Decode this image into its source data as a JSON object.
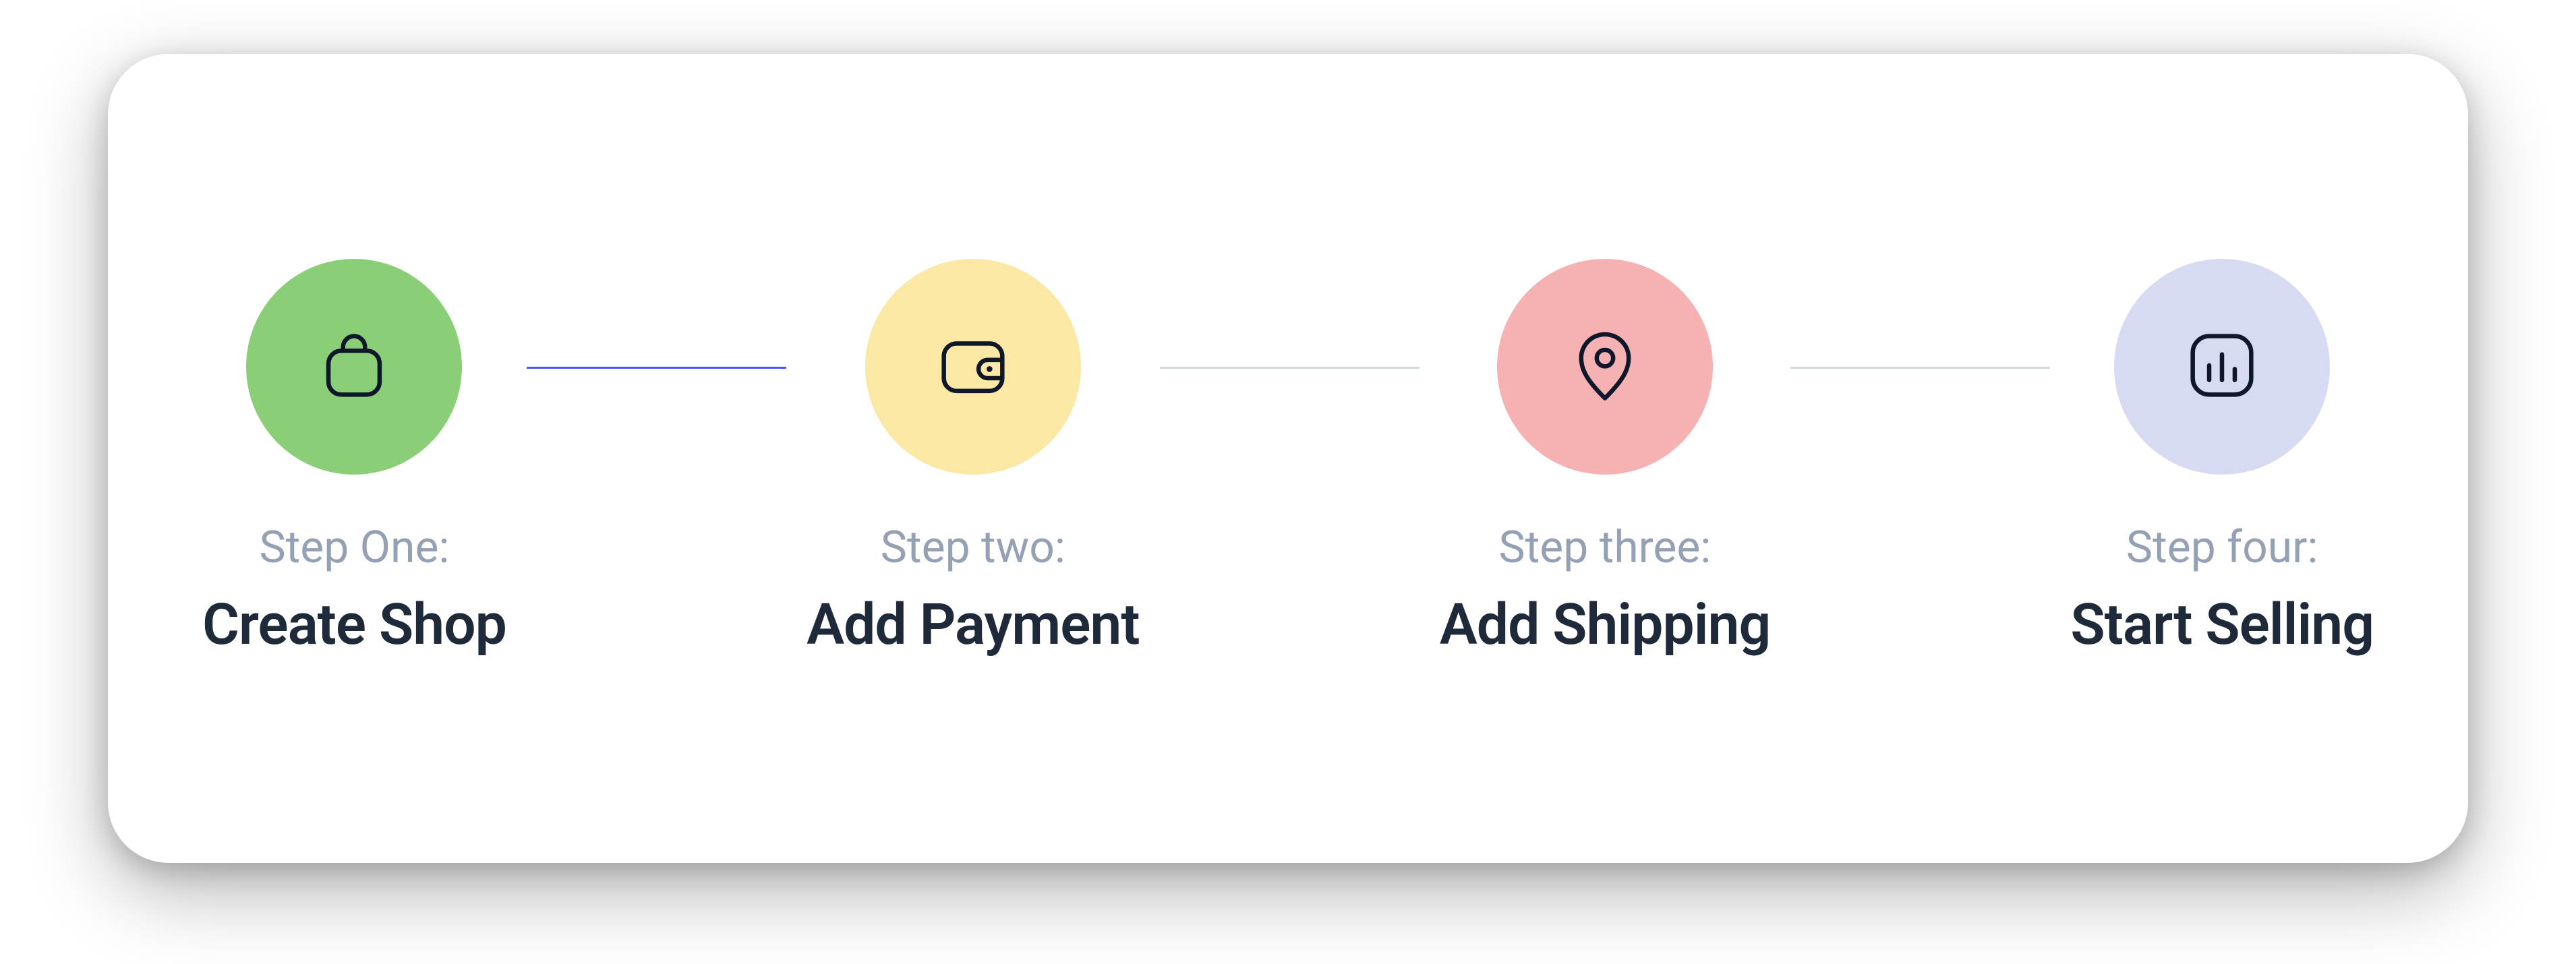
{
  "steps": [
    {
      "label": "Step One:",
      "title": "Create Shop",
      "color": "#8ace78",
      "icon": "shopping-bag-icon"
    },
    {
      "label": "Step two:",
      "title": "Add Payment",
      "color": "#fbe8a5",
      "icon": "wallet-icon"
    },
    {
      "label": "Step three:",
      "title": "Add Shipping",
      "color": "#f6b2b2",
      "icon": "location-pin-icon"
    },
    {
      "label": "Step four:",
      "title": "Start Selling",
      "color": "#d6daf3",
      "icon": "chart-icon"
    }
  ],
  "connectors": [
    {
      "active": true
    },
    {
      "active": false
    },
    {
      "active": false
    }
  ]
}
